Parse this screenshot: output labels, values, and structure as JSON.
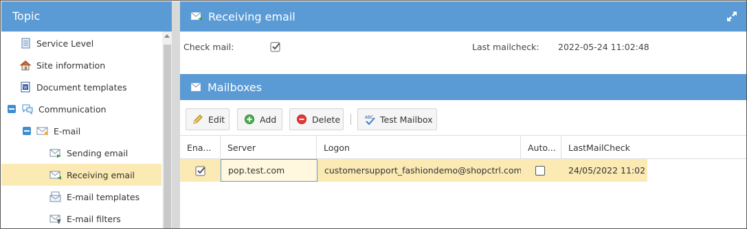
{
  "left_panel": {
    "title": "Topic",
    "items": [
      {
        "label": "Service Level",
        "icon": "document-list-icon",
        "level": 1
      },
      {
        "label": "Site information",
        "icon": "house-icon",
        "level": 1
      },
      {
        "label": "Document templates",
        "icon": "word-document-icon",
        "level": 1
      },
      {
        "label": "Communication",
        "icon": "speech-bubbles-icon",
        "level": 0,
        "expanded": true
      },
      {
        "label": "E-mail",
        "icon": "envelope-icon",
        "level": 1,
        "expanded": true
      },
      {
        "label": "Sending email",
        "icon": "envelope-send-icon",
        "level": 2
      },
      {
        "label": "Receiving email",
        "icon": "envelope-receive-icon",
        "level": 2,
        "selected": true
      },
      {
        "label": "E-mail templates",
        "icon": "envelope-template-icon",
        "level": 2
      },
      {
        "label": "E-mail filters",
        "icon": "envelope-filter-icon",
        "level": 2
      }
    ]
  },
  "receiving_panel": {
    "title": "Receiving email",
    "check_mail_label": "Check mail:",
    "check_mail_checked": true,
    "last_mailcheck_label": "Last mailcheck:",
    "last_mailcheck_value": "2022-05-24 11:02:48"
  },
  "mailboxes_panel": {
    "title": "Mailboxes",
    "toolbar": {
      "edit_label": "Edit",
      "add_label": "Add",
      "delete_label": "Delete",
      "test_label": "Test Mailbox"
    },
    "columns": [
      "Ena...",
      "Server",
      "Logon",
      "Auto...",
      "LastMailCheck"
    ],
    "rows": [
      {
        "enabled": true,
        "server": "pop.test.com",
        "logon": "customersupport_fashiondemo@shopctrl.com",
        "auto": false,
        "last_mail_check": "24/05/2022 11:02"
      }
    ]
  },
  "colors": {
    "header_blue": "#5b9bd5",
    "selection_yellow": "#fbeab3",
    "toggle_blue": "#3e8ed0"
  }
}
